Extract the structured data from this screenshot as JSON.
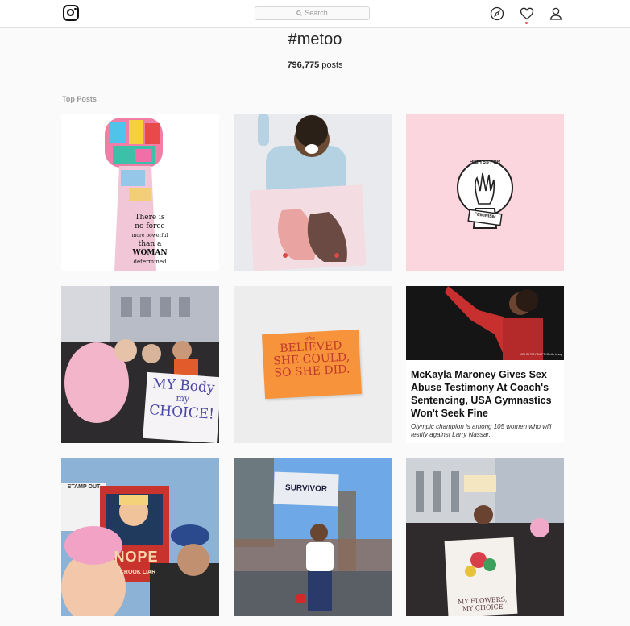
{
  "header": {
    "search_placeholder": "Search",
    "icons": [
      "instagram-logo-icon",
      "compass-icon",
      "heart-icon",
      "user-icon"
    ]
  },
  "hashtag": {
    "title": "#metoo",
    "post_count": "796,775",
    "post_count_suffix": " posts"
  },
  "section": {
    "label": "Top Posts"
  },
  "posts": [
    {
      "id": 1,
      "text_lines": [
        "There is",
        "no force",
        "more powerful",
        "than a",
        "WOMAN",
        "determined"
      ]
    },
    {
      "id": 2
    },
    {
      "id": 3,
      "badge_top": "HIGH 5S FOR",
      "badge_bottom": "FEMINISM"
    },
    {
      "id": 4,
      "sign_line1": "MY Body",
      "sign_line2": "my",
      "sign_line3": "CHOICE!"
    },
    {
      "id": 5,
      "card_top": "she",
      "card_line1": "BELIEVED",
      "card_line2": "SHE COULD,",
      "card_line3": "SO SHE DID."
    },
    {
      "id": 6,
      "photo_credit": "JOHN THYS/AFP/Getty Imag",
      "headline": "McKayla Maroney Gives Sex Abuse Testimony At Coach's Sentencing, USA Gymnastics Won't Seek Fine",
      "subline": "Olympic champion is among 105 women who will testify against Larry Nassar."
    },
    {
      "id": 7,
      "sign_top": "STAMP OUT",
      "sign_nope": "NOPE",
      "sign_bottom": "CROOK LIAR"
    },
    {
      "id": 8,
      "sign": "SURVIVOR"
    },
    {
      "id": 9,
      "sign_line1": "MY FLOWERS,",
      "sign_line2": "MY CHOICE"
    }
  ],
  "colors": {
    "accent_red": "#ed4956",
    "tile3_bg": "#fbd6df",
    "tile5_card": "#f7933b"
  }
}
